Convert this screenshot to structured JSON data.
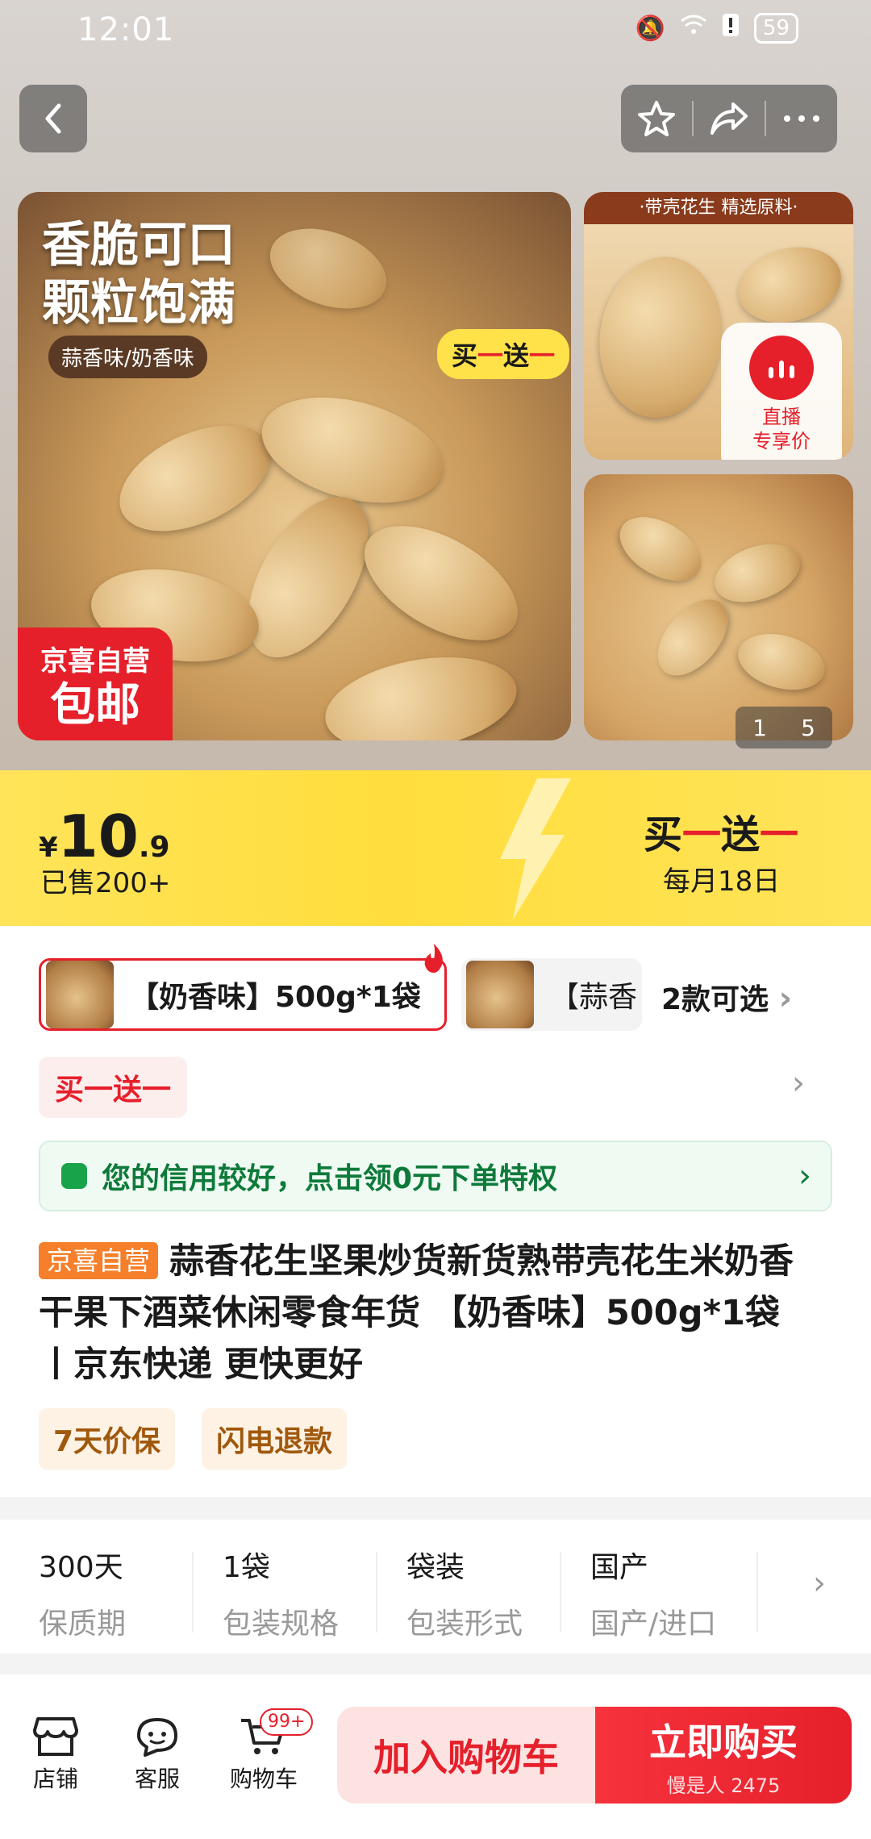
{
  "status": {
    "time": "12:01",
    "battery": "59"
  },
  "gallery": {
    "main_title_line1": "香脆可口",
    "main_title_line2": "颗粒饱满",
    "flavor_pill": "蒜香味/奶香味",
    "bogo_pill_a": "买",
    "bogo_pill_b": "一",
    "bogo_pill_c": "送",
    "bogo_pill_d": "一",
    "free_ship_top": "京喜自营",
    "free_ship_main": "包邮",
    "side_header": "·带壳花生 精选原料·",
    "live_line1": "直播",
    "live_line2": "专享价",
    "pager_current": "1",
    "pager_total": "5"
  },
  "price": {
    "currency": "¥",
    "integer": "10",
    "decimal": ".9",
    "sold": "已售200+",
    "promo_a": "买",
    "promo_b": "一",
    "promo_c": "送",
    "promo_d": "一",
    "promo_date": "每月18日"
  },
  "variants": {
    "selected": "【奶香味】500g*1袋",
    "other": "【蒜香",
    "count": "2款可选"
  },
  "promo_tag": "买一送一",
  "credit": {
    "text": "您的信用较好，点击领0元下单特权"
  },
  "product": {
    "seller_tag": "京喜自营",
    "title": "蒜香花生坚果炒货新货熟带壳花生米奶香干果下酒菜休闲零食年货 【奶香味】500g*1袋丨京东快递 更快更好"
  },
  "service_tags": [
    "7天价保",
    "闪电退款"
  ],
  "specs": [
    {
      "value": "300天",
      "key": "保质期"
    },
    {
      "value": "1袋",
      "key": "包装规格"
    },
    {
      "value": "袋装",
      "key": "包装形式"
    },
    {
      "value": "国产",
      "key": "国产/进口"
    }
  ],
  "bottom_bar": {
    "shop": "店铺",
    "service": "客服",
    "cart": "购物车",
    "cart_badge": "99+",
    "add_to_cart": "加入购物车",
    "buy_now": "立即购买",
    "buy_sub": "慢是人 2475"
  },
  "colors": {
    "accent_red": "#e5202b",
    "banner_yellow": "#ffe14a",
    "credit_green": "#0e7a3a"
  }
}
